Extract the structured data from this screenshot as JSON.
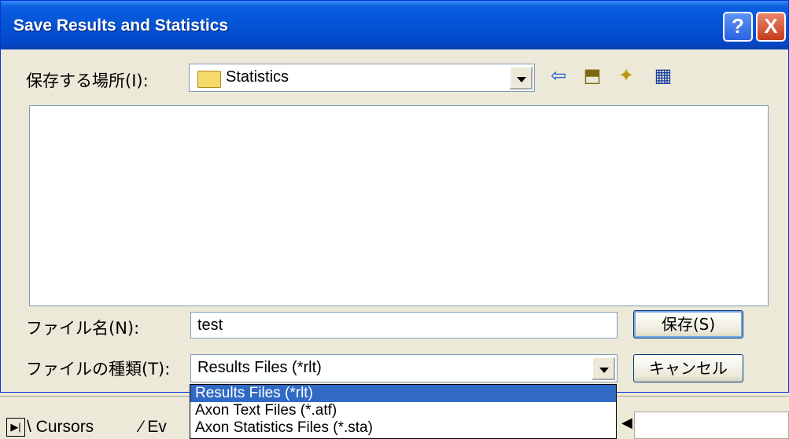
{
  "dialog": {
    "title": "Save Results and Statistics",
    "help_glyph": "?",
    "close_glyph": "X"
  },
  "location": {
    "label": "保存する場所(I):",
    "value": "Statistics"
  },
  "toolbar": {
    "back_glyph": "⇦",
    "up_glyph": "⬒",
    "new_folder_glyph": "✦",
    "views_glyph": "▦"
  },
  "filename": {
    "label": "ファイル名(N):",
    "value": "test"
  },
  "filetype": {
    "label": "ファイルの種類(T):",
    "value": "Results Files (*rlt)",
    "options": [
      "Results Files (*rlt)",
      "Axon Text Files (*.atf)",
      "Axon Statistics Files (*.sta)"
    ]
  },
  "buttons": {
    "save_label": "保存(S)",
    "cancel_label": "キャンセル"
  },
  "background": {
    "tab1": "Cursors",
    "tab2": "Ev"
  }
}
